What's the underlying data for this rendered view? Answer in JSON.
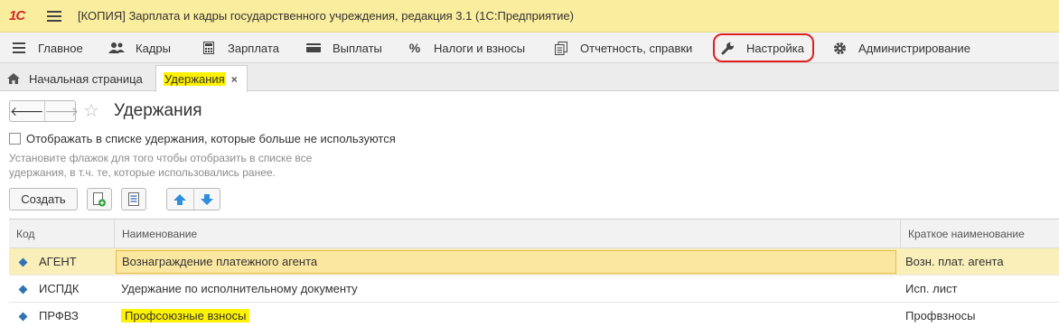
{
  "titlebar": {
    "logo": "1С",
    "title": "[КОПИЯ] Зарплата и кадры государственного учреждения, редакция 3.1  (1С:Предприятие)"
  },
  "menu": {
    "items": [
      {
        "label": "Главное",
        "icon": "hamburger-icon"
      },
      {
        "label": "Кадры",
        "icon": "people-icon"
      },
      {
        "label": "Зарплата",
        "icon": "calculator-icon"
      },
      {
        "label": "Выплаты",
        "icon": "wallet-icon"
      },
      {
        "label": "Налоги и взносы",
        "icon": "percent-icon"
      },
      {
        "label": "Отчетность, справки",
        "icon": "documents-icon"
      },
      {
        "label": "Настройка",
        "icon": "wrench-icon",
        "highlighted": true
      },
      {
        "label": "Администрирование",
        "icon": "gear-icon"
      }
    ],
    "highlight_color": "#e02020"
  },
  "tabs": {
    "home": "Начальная страница",
    "active": "Удержания",
    "close": "×"
  },
  "page": {
    "back": "🡐",
    "forward": "🡒",
    "star": "☆",
    "title": "Удержания",
    "checkbox_label": "Отображать в списке удержания, которые больше не используются",
    "checkbox_checked": false,
    "hint_line1": "Установите флажок для того чтобы отобразить в списке все",
    "hint_line2": "удержания, в т.ч. те, которые использовались ранее.",
    "create_button": "Создать"
  },
  "table": {
    "columns": [
      "Код",
      "Наименование",
      "Краткое наименование"
    ],
    "rows": [
      {
        "code": "АГЕНТ",
        "name": "Вознаграждение платежного агента",
        "short": "Возн. плат. агента",
        "selected": true
      },
      {
        "code": "ИСПДК",
        "name": "Удержание по исполнительному документу",
        "short": "Исп. лист",
        "selected": false
      },
      {
        "code": "ПРФВЗ",
        "name": "Профсоюзные взносы",
        "short": "Профвзносы",
        "selected": false,
        "marker": true
      }
    ]
  },
  "colors": {
    "title_bg": "#fbed9e",
    "menu_bg": "#f2f2f2",
    "selected_row": "#faefb9",
    "marker_yellow": "#fff200",
    "row_icon": "#2f73b4"
  }
}
